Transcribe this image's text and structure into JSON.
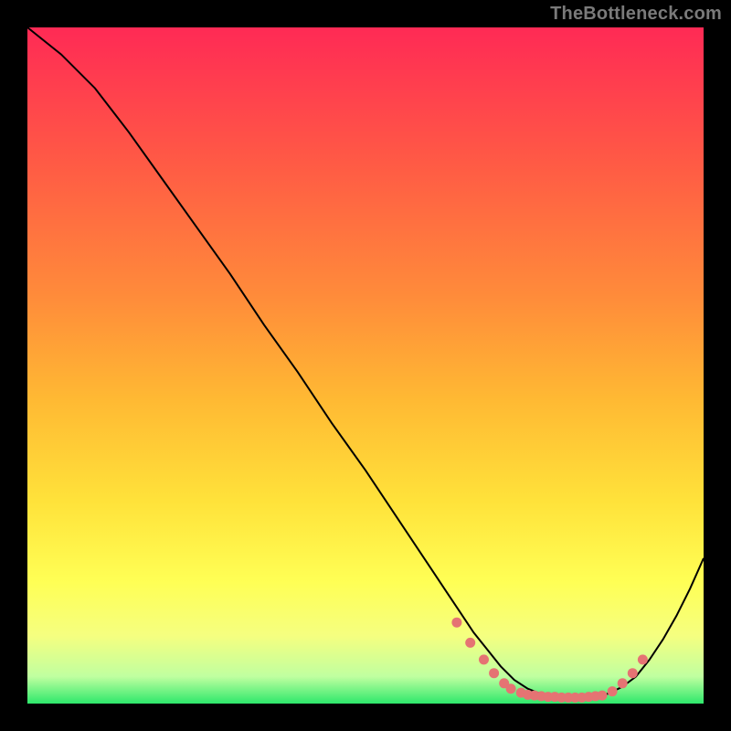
{
  "attribution": "TheBottleneck.com",
  "chart_data": {
    "type": "line",
    "title": "",
    "xlabel": "",
    "ylabel": "",
    "xlim": [
      0,
      100
    ],
    "ylim": [
      0,
      100
    ],
    "grid": false,
    "series": [
      {
        "name": "curve",
        "color": "#000000",
        "x": [
          0,
          5,
          10,
          15,
          20,
          25,
          30,
          35,
          40,
          45,
          50,
          55,
          60,
          62,
          64,
          66,
          68,
          70,
          72,
          74,
          76,
          78,
          80,
          82,
          84,
          86,
          88,
          90,
          92,
          94,
          96,
          98,
          100
        ],
        "y": [
          100,
          96,
          91,
          84.5,
          77.5,
          70.5,
          63.5,
          56,
          49,
          41.5,
          34.5,
          27,
          19.5,
          16.5,
          13.5,
          10.5,
          8,
          5.5,
          3.5,
          2.2,
          1.4,
          1.0,
          0.8,
          0.8,
          1.0,
          1.5,
          2.5,
          4.0,
          6.5,
          9.5,
          13.0,
          17.0,
          21.5
        ]
      },
      {
        "name": "valley-dots-left",
        "color": "#E57373",
        "style": "dots",
        "x": [
          63.5,
          65.5,
          67.5,
          69.0,
          70.5,
          71.5
        ],
        "y": [
          12.0,
          9.0,
          6.5,
          4.5,
          3.0,
          2.2
        ]
      },
      {
        "name": "valley-dots-bottom",
        "color": "#E57373",
        "style": "dots",
        "x": [
          73.0,
          74.0,
          75.0,
          76.0,
          77.0,
          78.0,
          79.0,
          80.0,
          81.0,
          82.0,
          83.0,
          84.0,
          85.0
        ],
        "y": [
          1.6,
          1.3,
          1.2,
          1.1,
          1.0,
          1.0,
          0.9,
          0.9,
          0.9,
          0.9,
          1.0,
          1.1,
          1.2
        ]
      },
      {
        "name": "valley-dots-right",
        "color": "#E57373",
        "style": "dots",
        "x": [
          86.5,
          88.0,
          89.5,
          91.0
        ],
        "y": [
          1.8,
          3.0,
          4.5,
          6.5
        ]
      }
    ],
    "background_gradient": {
      "stops": [
        {
          "offset": 0.0,
          "color": "#FF2A55"
        },
        {
          "offset": 0.2,
          "color": "#FF5A45"
        },
        {
          "offset": 0.4,
          "color": "#FF8C3A"
        },
        {
          "offset": 0.55,
          "color": "#FFB933"
        },
        {
          "offset": 0.7,
          "color": "#FFE23A"
        },
        {
          "offset": 0.82,
          "color": "#FFFF55"
        },
        {
          "offset": 0.9,
          "color": "#F5FF80"
        },
        {
          "offset": 0.96,
          "color": "#C0FFA0"
        },
        {
          "offset": 1.0,
          "color": "#2EE86B"
        }
      ]
    }
  }
}
